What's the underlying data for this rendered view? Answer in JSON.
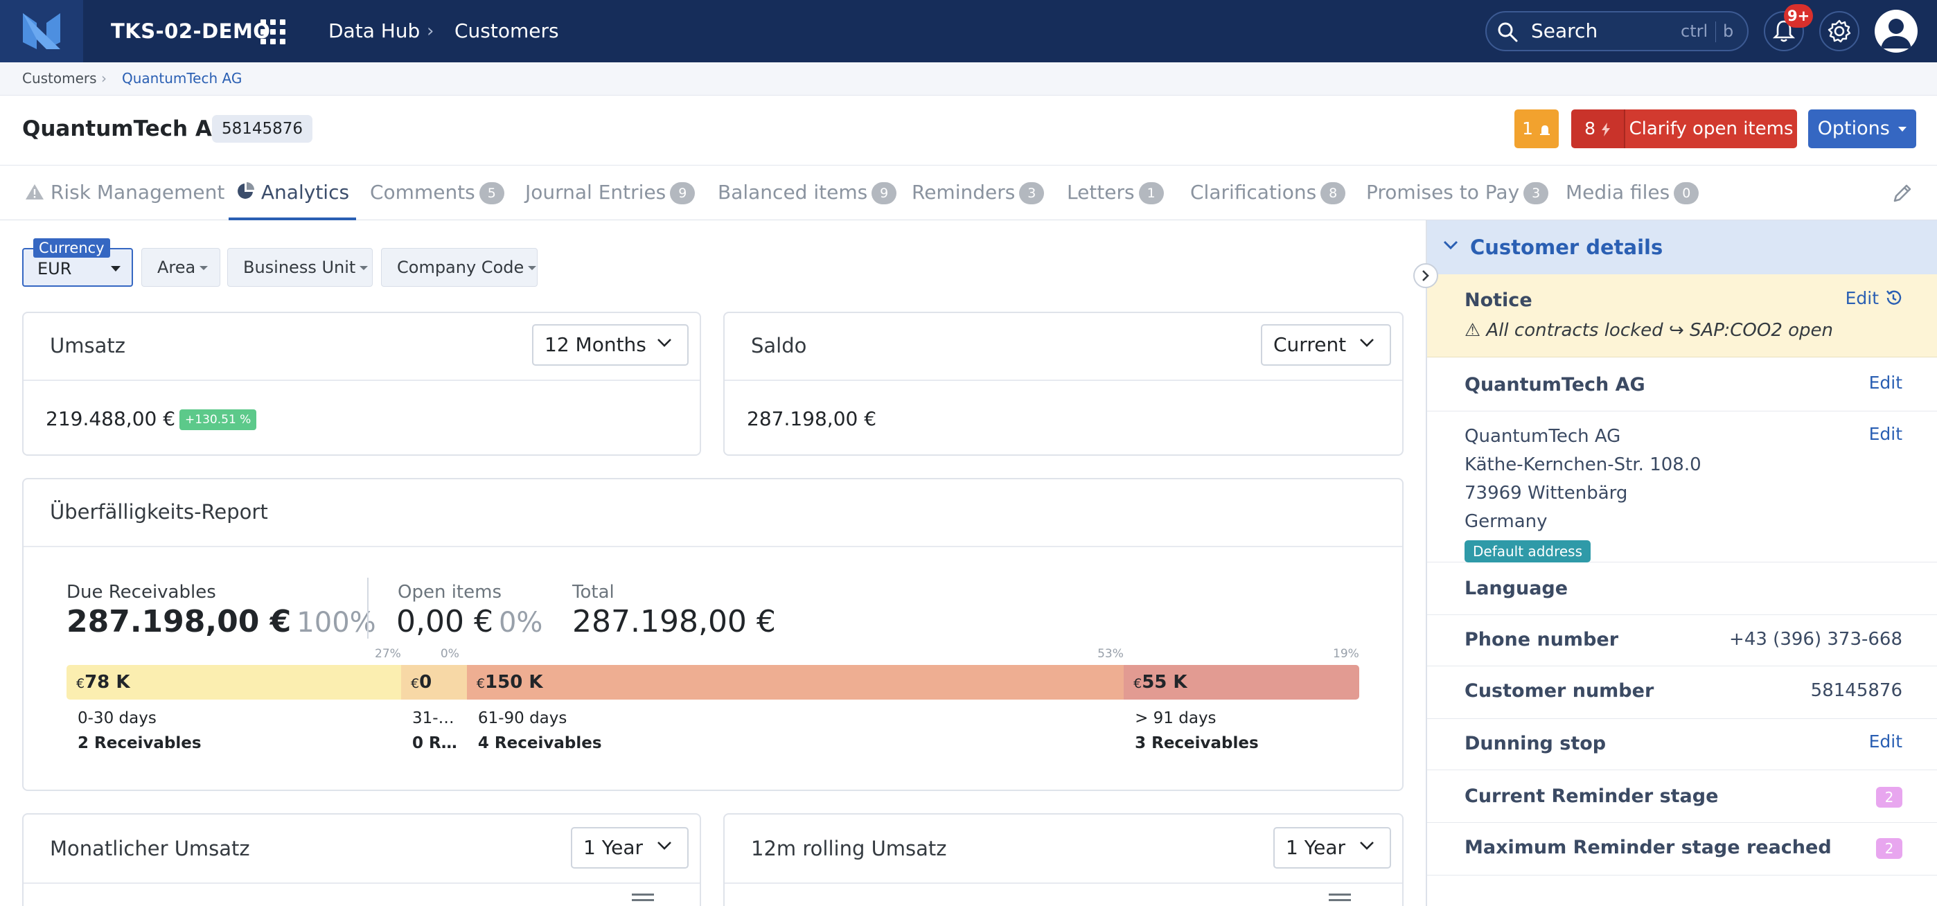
{
  "topbar": {
    "system_name": "TKS-02-DEMO",
    "nav": [
      "Data Hub",
      "Customers"
    ],
    "search_label": "Search",
    "search_kbd": [
      "ctrl",
      "b"
    ],
    "notification_count": "9+",
    "colors": {
      "bar": "#162d5a",
      "accent": "#2a5fb3"
    }
  },
  "breadcrumb": [
    "Customers",
    "QuantumTech AG"
  ],
  "header": {
    "title": "QuantumTech AG",
    "customer_id": "58145876",
    "alert_count": "1",
    "clarify_count": "8",
    "clarify_label": "Clarify open items",
    "options_label": "Options"
  },
  "tabs": [
    {
      "label": "Risk Management",
      "count": null,
      "icon": "warning-icon"
    },
    {
      "label": "Analytics",
      "count": null,
      "icon": "pie-chart-icon",
      "active": true
    },
    {
      "label": "Comments",
      "count": "5"
    },
    {
      "label": "Journal Entries",
      "count": "9"
    },
    {
      "label": "Balanced items",
      "count": "9"
    },
    {
      "label": "Reminders",
      "count": "3"
    },
    {
      "label": "Letters",
      "count": "1"
    },
    {
      "label": "Clarifications",
      "count": "8"
    },
    {
      "label": "Promises to Pay",
      "count": "3"
    },
    {
      "label": "Media files",
      "count": "0"
    }
  ],
  "filters": {
    "currency_label": "Currency",
    "currency_value": "EUR",
    "others": [
      "Area",
      "Business Unit",
      "Company Code"
    ]
  },
  "umsatz": {
    "title": "Umsatz",
    "period": "12 Months",
    "value": "219.488,00 €",
    "change": "+130.51 %"
  },
  "saldo": {
    "title": "Saldo",
    "period": "Current",
    "value": "287.198,00 €"
  },
  "aging": {
    "title": "Überfälligkeits-Report",
    "due_label": "Due Receivables",
    "due_value": "287.198,00 €",
    "due_pct": "100%",
    "open_label": "Open items",
    "open_value": "0,00 €",
    "open_pct": "0%",
    "total_label": "Total",
    "total_value": "287.198,00 €",
    "buckets": [
      {
        "pct": "27%",
        "share": 0.27,
        "amount": "78 K",
        "days": "0-30 days",
        "receivables": "2 Receivables",
        "color": "#fbeeb0"
      },
      {
        "pct": "0%",
        "share": 0.0,
        "amount": "0",
        "days": "31-…",
        "receivables": "0 R…",
        "color": "#f7d8a6"
      },
      {
        "pct": "53%",
        "share": 0.53,
        "amount": "150 K",
        "days": "61-90 days",
        "receivables": "4 Receivables",
        "color": "#eeae92"
      },
      {
        "pct": "19%",
        "share": 0.19,
        "amount": "55 K",
        "days": "> 91 days",
        "receivables": "3 Receivables",
        "color": "#e29b92"
      }
    ],
    "currency_symbol": "€"
  },
  "monthly": {
    "title": "Monatlicher Umsatz",
    "period": "1 Year"
  },
  "rolling": {
    "title": "12m rolling Umsatz",
    "period": "1 Year"
  },
  "panel": {
    "title": "Customer details",
    "notice_label": "Notice",
    "notice_edit": "Edit",
    "notice_text": "⚠ All contracts locked ↪ SAP:COO2 open",
    "name_label": "QuantumTech AG",
    "edit": "Edit",
    "address": [
      "QuantumTech AG",
      "Käthe-Kernchen-Str. 108.0",
      "73969 Wittenbärg",
      "Germany"
    ],
    "default_address": "Default address",
    "language_label": "Language",
    "phone_label": "Phone number",
    "phone_value": "+43 (396) 373-668",
    "custno_label": "Customer number",
    "custno_value": "58145876",
    "dunning_label": "Dunning stop",
    "reminder_label": "Current Reminder stage",
    "reminder_value": "2",
    "max_reminder_label": "Maximum Reminder stage reached",
    "max_reminder_value": "2"
  }
}
